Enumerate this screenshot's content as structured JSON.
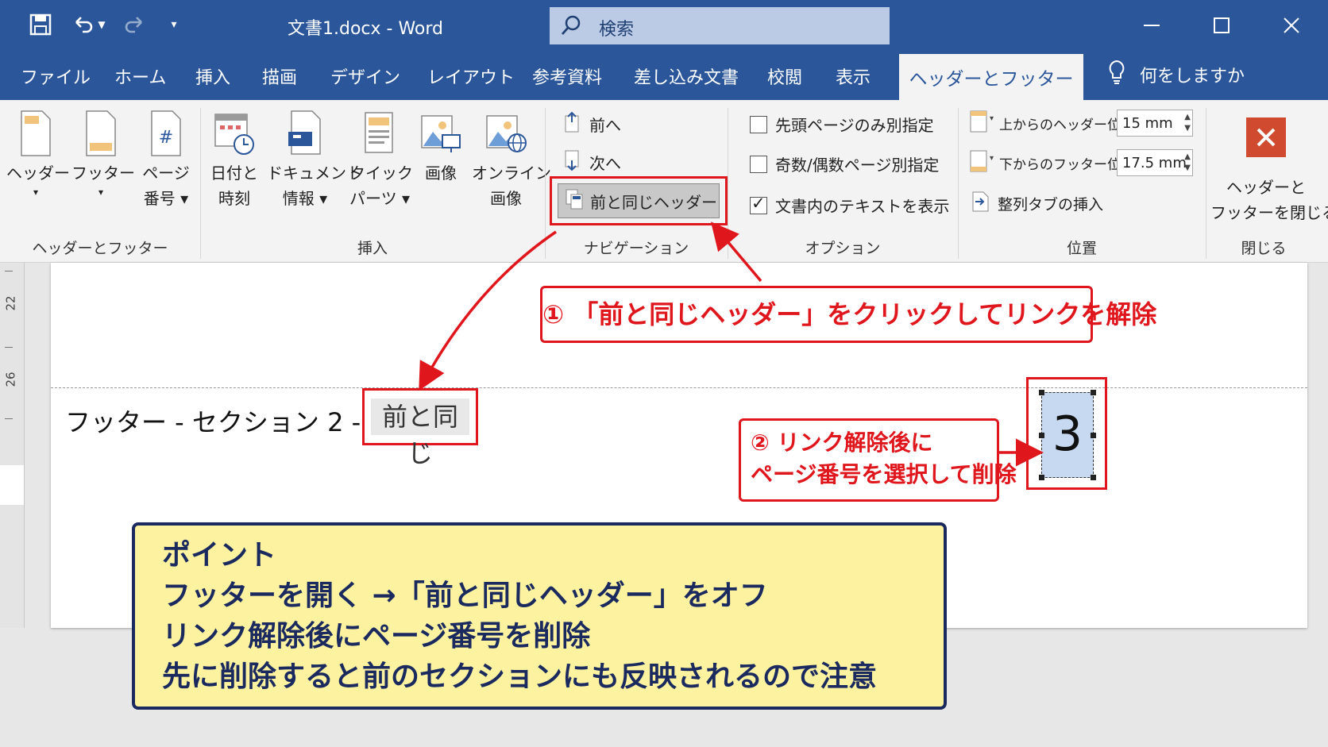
{
  "title_bar": {
    "doc_title": "文書1.docx  -  Word",
    "search_placeholder": "検索"
  },
  "menu": {
    "tabs": [
      "ファイル",
      "ホーム",
      "挿入",
      "描画",
      "デザイン",
      "レイアウト",
      "参考資料",
      "差し込み文書",
      "校閲",
      "表示"
    ],
    "active_tab": "ヘッダーとフッター",
    "tell_me": "何をしますか"
  },
  "ribbon": {
    "header_footer_group": {
      "label": "ヘッダーとフッター",
      "header": [
        "ヘッダー",
        "▾"
      ],
      "footer": [
        "フッター",
        "▾"
      ],
      "page_number": [
        "ページ",
        "番号 ▾"
      ]
    },
    "insert_group": {
      "label": "挿入",
      "date_time": [
        "日付と",
        "時刻"
      ],
      "doc_info": [
        "ドキュメント",
        "情報 ▾"
      ],
      "quick_parts": [
        "クイック",
        "パーツ ▾"
      ],
      "picture": [
        "画像",
        ""
      ],
      "online_picture": [
        "オンライン",
        "画像"
      ]
    },
    "navigation_group": {
      "label": "ナビゲーション",
      "previous": "前へ",
      "next": "次へ",
      "link_to_previous": "前と同じヘッダー"
    },
    "options_group": {
      "label": "オプション",
      "different_first": "先頭ページのみ別指定",
      "different_odd_even": "奇数/偶数ページ別指定",
      "show_document_text": "文書内のテキストを表示",
      "show_document_text_checked": true
    },
    "position_group": {
      "label": "位置",
      "header_from_top_label": "上からのヘッダー位置:",
      "header_from_top_value": "15 mm",
      "footer_from_bottom_label": "下からのフッター位置:",
      "footer_from_bottom_value": "17.5 mm",
      "insert_alignment_tab": "整列タブの挿入"
    },
    "close_group": {
      "label": "閉じる",
      "close_button": [
        "ヘッダーと",
        "フッターを閉じる"
      ]
    }
  },
  "ruler": {
    "numbers": [
      "22",
      "26"
    ]
  },
  "document": {
    "footer_label": "フッター - セクション 2 -",
    "same_as_previous": "前と同じ",
    "page_number": "3"
  },
  "callouts": {
    "step1": "① 「前と同じヘッダー」をクリックしてリンクを解除",
    "step2": [
      "② リンク解除後に",
      "ページ番号を選択して削除"
    ]
  },
  "point": {
    "title": "ポイント",
    "lines": [
      "フッターを開く →「前と同じヘッダー」をオフ",
      "リンク解除後にページ番号を削除",
      "先に削除すると前のセクションにも反映されるので注意"
    ]
  },
  "colors": {
    "brand": "#2b579a",
    "highlight_red": "#e0161d",
    "point_bg": "#fdf2a0",
    "point_border": "#1a2a5e"
  }
}
